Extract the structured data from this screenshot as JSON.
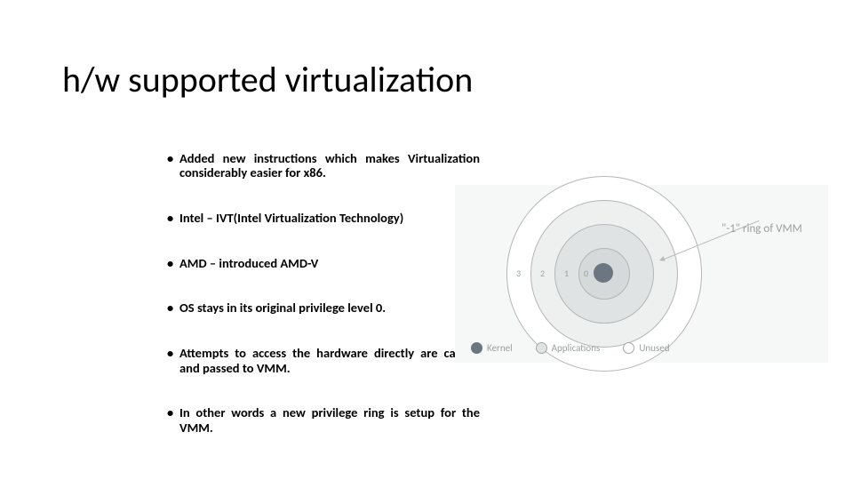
{
  "title": "h/w supported virtualization",
  "bullets": [
    "Added new instructions which makes Virtualization considerably easier for x86.",
    "Intel – IVT(Intel Virtualization Technology)",
    "AMD – introduced AMD-V",
    "OS stays in its original privilege level 0.",
    "Attempts to access the hardware directly are caught and passed to VMM.",
    "In other words a new privilege ring is setup for the VMM."
  ],
  "figure": {
    "ring_labels": [
      "3",
      "2",
      "1",
      "0"
    ],
    "callout": "\"-1\" ring of VMM",
    "legend": {
      "kernel": "Kernel",
      "applications": "Applications",
      "unused": "Unused"
    }
  }
}
